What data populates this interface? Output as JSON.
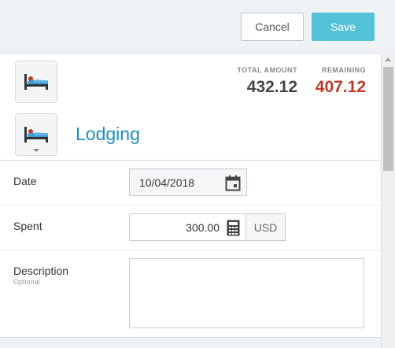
{
  "toolbar": {
    "cancel_label": "Cancel",
    "save_label": "Save"
  },
  "summary": {
    "total_label": "TOTAL AMOUNT",
    "total_value": "432.12",
    "remaining_label": "REMAINING",
    "remaining_value": "407.12"
  },
  "category": {
    "icon": "bed-icon",
    "title": "Lodging"
  },
  "form": {
    "date": {
      "label": "Date",
      "value": "10/04/2018",
      "icon": "calendar-icon"
    },
    "spent": {
      "label": "Spent",
      "value": "300.00",
      "currency": "USD",
      "icon": "calculator-icon"
    },
    "description": {
      "label": "Description",
      "sublabel": "Optional",
      "value": ""
    }
  },
  "colors": {
    "accent": "#54c3d8",
    "title": "#1b8fc0",
    "remaining": "#c0392b"
  }
}
